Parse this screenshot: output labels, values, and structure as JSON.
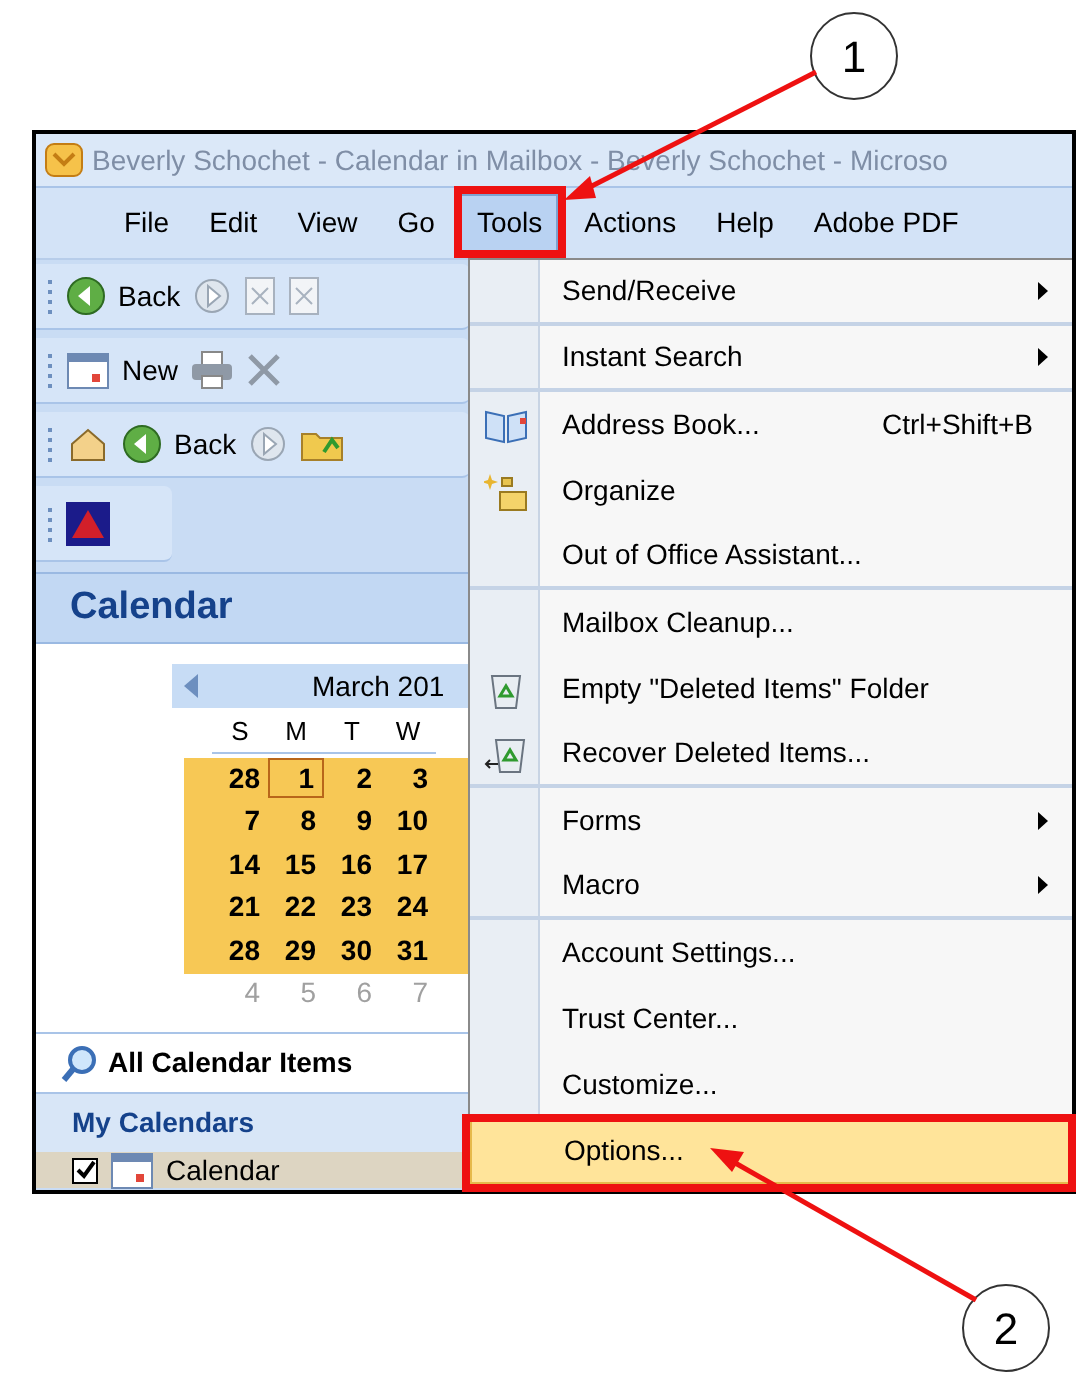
{
  "window": {
    "title": "Beverly Schochet - Calendar in Mailbox - Beverly Schochet - Microso"
  },
  "menu_bar": [
    {
      "label": "File",
      "selected": false
    },
    {
      "label": "Edit",
      "selected": false
    },
    {
      "label": "View",
      "selected": false
    },
    {
      "label": "Go",
      "selected": false
    },
    {
      "label": "Tools",
      "selected": true
    },
    {
      "label": "Actions",
      "selected": false
    },
    {
      "label": "Help",
      "selected": false
    },
    {
      "label": "Adobe PDF",
      "selected": false
    }
  ],
  "toolbars": [
    {
      "kind": "standard",
      "label": "Back"
    },
    {
      "kind": "new",
      "label": "New"
    },
    {
      "kind": "web",
      "label": "Back"
    },
    {
      "kind": "addin"
    }
  ],
  "navigation_pane": {
    "title": "Calendar",
    "mini_calendar": {
      "month": "March 201",
      "weekdays": [
        "S",
        "M",
        "T",
        "W"
      ],
      "weeks": [
        [
          {
            "day": "28",
            "today": false,
            "muted": false
          },
          {
            "day": "1",
            "today": true,
            "muted": false
          },
          {
            "day": "2",
            "today": false,
            "muted": false
          },
          {
            "day": "3",
            "today": false,
            "muted": false
          }
        ],
        [
          {
            "day": "7",
            "today": false,
            "muted": false
          },
          {
            "day": "8",
            "today": false,
            "muted": false
          },
          {
            "day": "9",
            "today": false,
            "muted": false
          },
          {
            "day": "10",
            "today": false,
            "muted": false
          }
        ],
        [
          {
            "day": "14",
            "today": false,
            "muted": false
          },
          {
            "day": "15",
            "today": false,
            "muted": false
          },
          {
            "day": "16",
            "today": false,
            "muted": false
          },
          {
            "day": "17",
            "today": false,
            "muted": false
          }
        ],
        [
          {
            "day": "21",
            "today": false,
            "muted": false
          },
          {
            "day": "22",
            "today": false,
            "muted": false
          },
          {
            "day": "23",
            "today": false,
            "muted": false
          },
          {
            "day": "24",
            "today": false,
            "muted": false
          }
        ],
        [
          {
            "day": "28",
            "today": false,
            "muted": false
          },
          {
            "day": "29",
            "today": false,
            "muted": false
          },
          {
            "day": "30",
            "today": false,
            "muted": false
          },
          {
            "day": "31",
            "today": false,
            "muted": false
          }
        ],
        [
          {
            "day": "4",
            "today": false,
            "muted": true
          },
          {
            "day": "5",
            "today": false,
            "muted": true
          },
          {
            "day": "6",
            "today": false,
            "muted": true
          },
          {
            "day": "7",
            "today": false,
            "muted": true
          }
        ]
      ]
    },
    "all_items": "All Calendar Items",
    "section": "My Calendars",
    "calendars": [
      {
        "label": "Calendar",
        "checked": true
      }
    ]
  },
  "tools_menu": [
    {
      "label": "Send/Receive",
      "submenu": true,
      "selected": false,
      "separator_after": true
    },
    {
      "label": "Instant Search",
      "submenu": true,
      "selected": false,
      "separator_after": true
    },
    {
      "label": "Address Book...",
      "shortcut": "Ctrl+Shift+B",
      "submenu": false,
      "selected": false,
      "separator_after": false
    },
    {
      "label": "Organize",
      "submenu": false,
      "selected": false,
      "separator_after": false
    },
    {
      "label": "Out of Office Assistant...",
      "submenu": false,
      "selected": false,
      "separator_after": true
    },
    {
      "label": "Mailbox Cleanup...",
      "submenu": false,
      "selected": false,
      "separator_after": false
    },
    {
      "label": "Empty \"Deleted Items\" Folder",
      "submenu": false,
      "selected": false,
      "separator_after": false
    },
    {
      "label": "Recover Deleted Items...",
      "submenu": false,
      "selected": false,
      "separator_after": true
    },
    {
      "label": "Forms",
      "submenu": true,
      "selected": false,
      "separator_after": false
    },
    {
      "label": "Macro",
      "submenu": true,
      "selected": false,
      "separator_after": true
    },
    {
      "label": "Account Settings...",
      "submenu": false,
      "selected": false,
      "separator_after": false
    },
    {
      "label": "Trust Center...",
      "submenu": false,
      "selected": false,
      "separator_after": false
    },
    {
      "label": "Customize...",
      "submenu": false,
      "selected": false,
      "separator_after": false
    },
    {
      "label": "Options...",
      "submenu": false,
      "selected": true,
      "separator_after": false
    }
  ],
  "callouts": [
    {
      "label": "1"
    },
    {
      "label": "2"
    }
  ]
}
